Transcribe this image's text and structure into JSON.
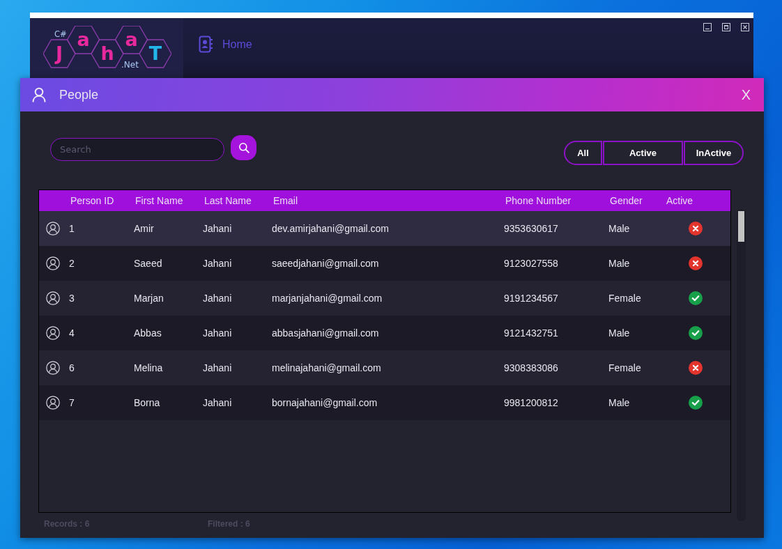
{
  "main_window": {
    "logo": {
      "prefix": "C#",
      "letters": [
        {
          "text": "J",
          "color": "#e8299e"
        },
        {
          "text": "a",
          "color": "#e8299e"
        },
        {
          "text": "h",
          "color": "#e8299e"
        },
        {
          "text": "a",
          "color": "#e8299e"
        },
        {
          "text": "T",
          "color": "#22b6ea"
        }
      ],
      "suffix": ".Net"
    },
    "nav_item": {
      "label": "Home"
    }
  },
  "dialog": {
    "title": "People",
    "close_label": "X"
  },
  "search": {
    "placeholder": "Search"
  },
  "filters": [
    {
      "label": "All"
    },
    {
      "label": "Active"
    },
    {
      "label": "InActive"
    }
  ],
  "table": {
    "columns": [
      "Person ID",
      "First Name",
      "Last Name",
      "Email",
      "Phone Number",
      "Gender",
      "Active"
    ],
    "rows": [
      {
        "id": "1",
        "first_name": "Amir",
        "last_name": "Jahani",
        "email": "dev.amirjahani@gmail.com",
        "phone": "9353630617",
        "gender": "Male",
        "active": false,
        "selected": true
      },
      {
        "id": "2",
        "first_name": "Saeed",
        "last_name": "Jahani",
        "email": "saeedjahani@gmail.com",
        "phone": "9123027558",
        "gender": "Male",
        "active": false,
        "selected": false
      },
      {
        "id": "3",
        "first_name": "Marjan",
        "last_name": "Jahani",
        "email": "marjanjahani@gmail.com",
        "phone": "9191234567",
        "gender": "Female",
        "active": true,
        "selected": false
      },
      {
        "id": "4",
        "first_name": "Abbas",
        "last_name": "Jahani",
        "email": "abbasjahani@gmail.com",
        "phone": "9121432751",
        "gender": "Male",
        "active": true,
        "selected": false
      },
      {
        "id": "6",
        "first_name": "Melina",
        "last_name": "Jahani",
        "email": "melinajahani@gmail.com",
        "phone": "9308383086",
        "gender": "Female",
        "active": false,
        "selected": false
      },
      {
        "id": "7",
        "first_name": "Borna",
        "last_name": "Jahani",
        "email": "bornajahani@gmail.com",
        "phone": "9981200812",
        "gender": "Male",
        "active": true,
        "selected": false
      }
    ]
  },
  "status_bar": {
    "records": "Records : 6",
    "filtered": "Filtered : 6"
  }
}
